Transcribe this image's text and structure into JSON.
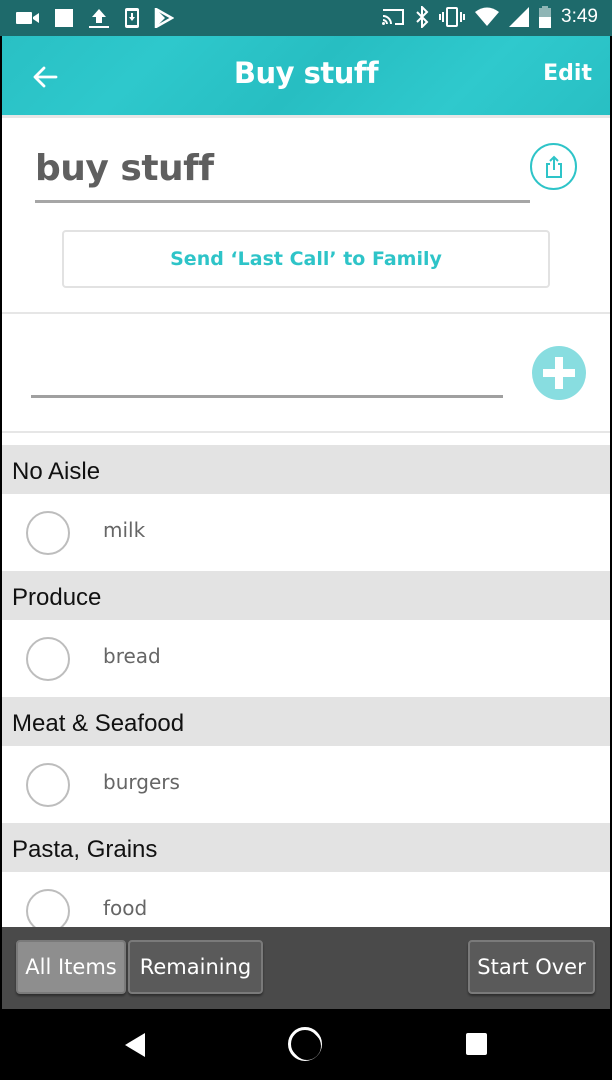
{
  "status_bar": {
    "time": "3:49",
    "left_icons": [
      "video-camera-icon",
      "square-notification-icon",
      "upload-icon",
      "phone-download-icon",
      "play-store-icon"
    ],
    "right_icons": [
      "cast-icon",
      "bluetooth-icon",
      "vibrate-icon",
      "wifi-icon",
      "cell-signal-icon",
      "battery-icon"
    ]
  },
  "app_bar": {
    "title": "Buy stuff",
    "back_icon": "arrow-left-icon",
    "edit_label": "Edit",
    "color": "#2ec4c8"
  },
  "list": {
    "name": "buy stuff",
    "share_icon": "share-icon",
    "last_call_label": "Send ‘Last Call’ to Family",
    "add_item_value": "",
    "add_item_placeholder": "",
    "add_icon": "plus-icon"
  },
  "sections": [
    {
      "title": "No Aisle",
      "items": [
        {
          "label": "milk",
          "checked": false
        }
      ]
    },
    {
      "title": "Produce",
      "items": [
        {
          "label": "bread",
          "checked": false
        }
      ]
    },
    {
      "title": "Meat & Seafood",
      "items": [
        {
          "label": "burgers",
          "checked": false
        }
      ]
    },
    {
      "title": "Pasta, Grains",
      "items": [
        {
          "label": "food",
          "checked": false
        }
      ]
    }
  ],
  "toolbar": {
    "all_items_label": "All Items",
    "remaining_label": "Remaining",
    "start_over_label": "Start Over",
    "active": "All Items"
  },
  "nav_bar": {
    "back_icon": "nav-back-icon",
    "home_icon": "nav-home-icon",
    "recents_icon": "nav-recents-icon"
  }
}
